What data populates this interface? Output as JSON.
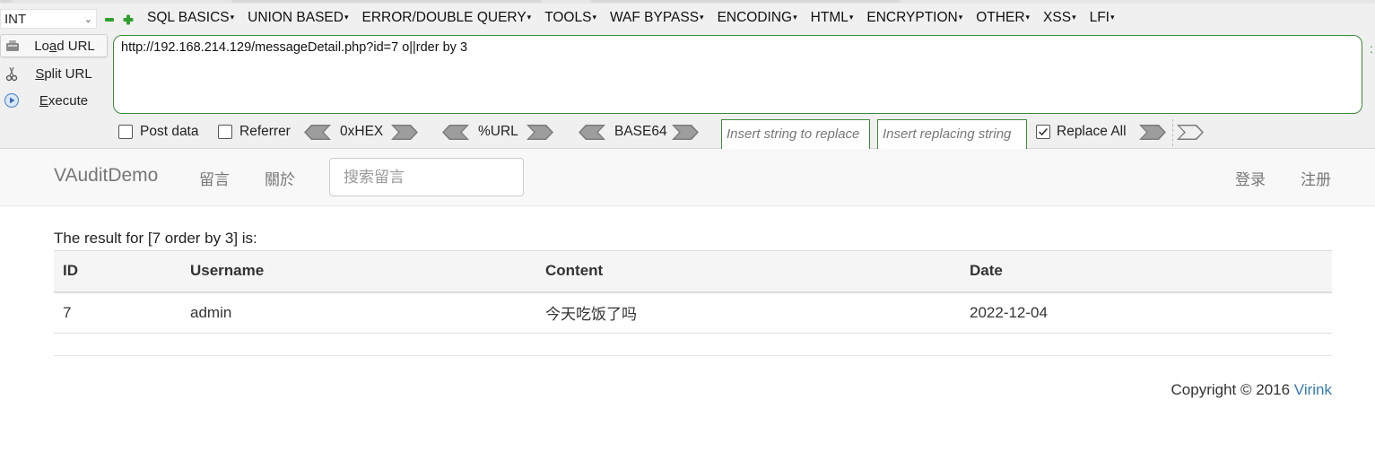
{
  "hackbar": {
    "type_select": "INT",
    "menus": [
      "SQL BASICS",
      "UNION BASED",
      "ERROR/DOUBLE QUERY",
      "TOOLS",
      "WAF BYPASS",
      "ENCODING",
      "HTML",
      "ENCRYPTION",
      "OTHER",
      "XSS",
      "LFI"
    ],
    "buttons": {
      "load_prefix": "Lo",
      "load_underlined": "a",
      "load_suffix": "d URL",
      "split_underlined": "S",
      "split_suffix": "plit URL",
      "exec_underlined": "E",
      "exec_suffix": "xecute"
    },
    "url": "http://192.168.214.129/messageDetail.php?id=7 o||rder by 3",
    "options": {
      "post_data": "Post data",
      "referrer": "Referrer",
      "hex": "0xHEX",
      "url_enc": "%URL",
      "base64": "BASE64",
      "replace_string_placeholder": "Insert string to replace",
      "replacing_string_placeholder": "Insert replacing string",
      "replace_all": "Replace All"
    },
    "colors": {
      "accent_green": "#3a8a3a",
      "plus_green": "#2ea02e"
    }
  },
  "navbar": {
    "brand": "VAuditDemo",
    "links": [
      "留言",
      "關於"
    ],
    "search_placeholder": "搜索留言",
    "right_links": [
      "登录",
      "注册"
    ]
  },
  "result": {
    "heading": "The result for [7 order by 3] is:",
    "columns": [
      "ID",
      "Username",
      "Content",
      "Date"
    ],
    "rows": [
      [
        "7",
        "admin",
        "今天吃饭了吗",
        "2022-12-04"
      ]
    ]
  },
  "footer": {
    "text": "Copyright © 2016 ",
    "link": "Virink",
    "link_color": "#337ab7"
  }
}
